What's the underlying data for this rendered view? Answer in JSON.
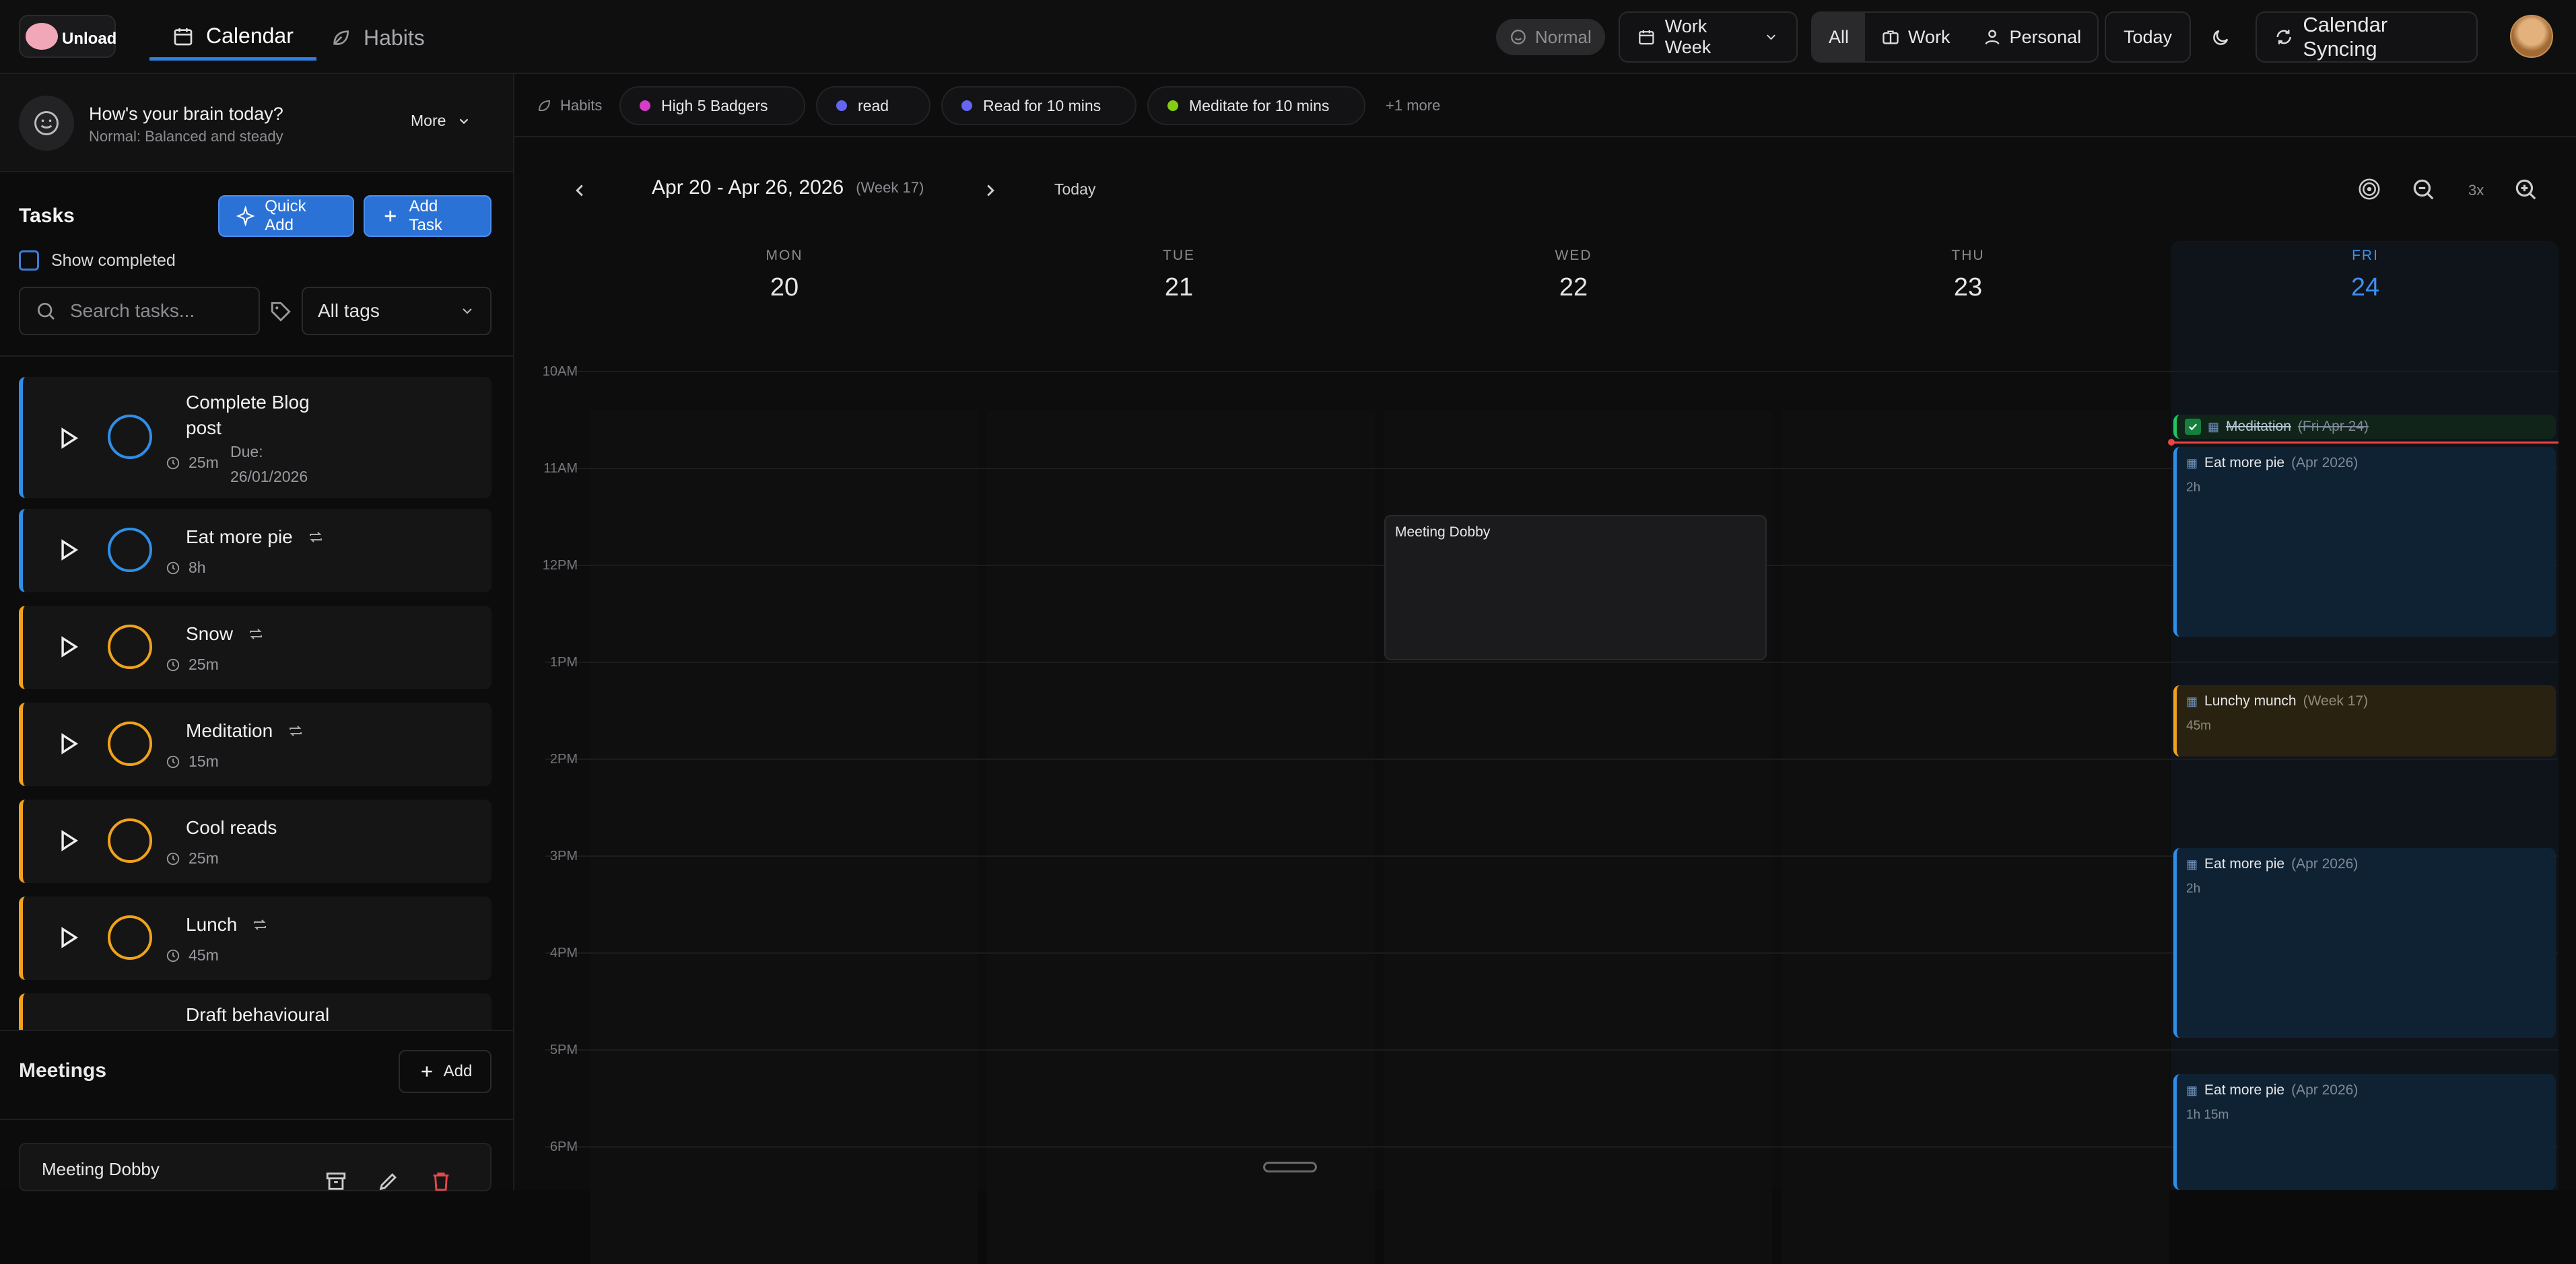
{
  "app": {
    "brand": "Unload"
  },
  "nav": {
    "calendar": "Calendar",
    "habits": "Habits"
  },
  "header": {
    "mood": "Normal",
    "view": "Work Week",
    "filter_all": "All",
    "filter_work": "Work",
    "filter_personal": "Personal",
    "today": "Today",
    "sync": "Calendar Syncing"
  },
  "brain": {
    "question": "How's your brain today?",
    "status": "Normal: Balanced and steady",
    "more": "More"
  },
  "tasks": {
    "title": "Tasks",
    "quick_add": "Quick Add",
    "add_task": "Add Task",
    "show_completed": "Show completed",
    "search_placeholder": "Search tasks...",
    "tags": "All tags",
    "items": [
      {
        "title_l1": "Complete Blog",
        "title_l2": "post",
        "duration": "25m",
        "due_l1": "Due:",
        "due_l2": "26/01/2026"
      },
      {
        "title": "Eat more pie",
        "duration": "8h"
      },
      {
        "title": "Snow",
        "duration": "25m"
      },
      {
        "title": "Meditation",
        "duration": "15m"
      },
      {
        "title": "Cool reads",
        "duration": "25m"
      },
      {
        "title": "Lunch",
        "duration": "45m"
      },
      {
        "title": "Draft behavioural"
      }
    ]
  },
  "meetings": {
    "title": "Meetings",
    "add": "Add",
    "item": "Meeting Dobby"
  },
  "habits_bar": {
    "label": "Habits",
    "chips": [
      {
        "name": "High 5 Badgers",
        "color": "#d63cc8"
      },
      {
        "name": "read",
        "color": "#6466f1"
      },
      {
        "name": "Read for 10 mins",
        "color": "#6466f1"
      },
      {
        "name": "Meditate for 10 mins",
        "color": "#84cc16"
      }
    ],
    "more": "+1 more"
  },
  "calendar": {
    "range": "Apr 20 - Apr 26, 2026",
    "week": "(Week 17)",
    "today": "Today",
    "zoom": "3x",
    "days": [
      {
        "dow": "MON",
        "num": "20"
      },
      {
        "dow": "TUE",
        "num": "21"
      },
      {
        "dow": "WED",
        "num": "22"
      },
      {
        "dow": "THU",
        "num": "23"
      },
      {
        "dow": "FRI",
        "num": "24"
      }
    ],
    "hours": [
      "10AM",
      "11AM",
      "12PM",
      "1PM",
      "2PM",
      "3PM",
      "4PM",
      "5PM",
      "6PM"
    ],
    "events": {
      "meditation": {
        "title": "Meditation",
        "sub": "(Fri Apr 24)"
      },
      "pie1": {
        "title": "Eat more pie",
        "sub": "(Apr 2026)",
        "dur": "2h"
      },
      "dobby": {
        "title": "Meeting Dobby"
      },
      "lunch": {
        "title": "Lunchy munch",
        "sub": "(Week 17)",
        "dur": "45m"
      },
      "pie2": {
        "title": "Eat more pie",
        "sub": "(Apr 2026)",
        "dur": "2h"
      },
      "pie3": {
        "title": "Eat more pie",
        "sub": "(Apr 2026)",
        "dur": "1h 15m"
      }
    }
  }
}
